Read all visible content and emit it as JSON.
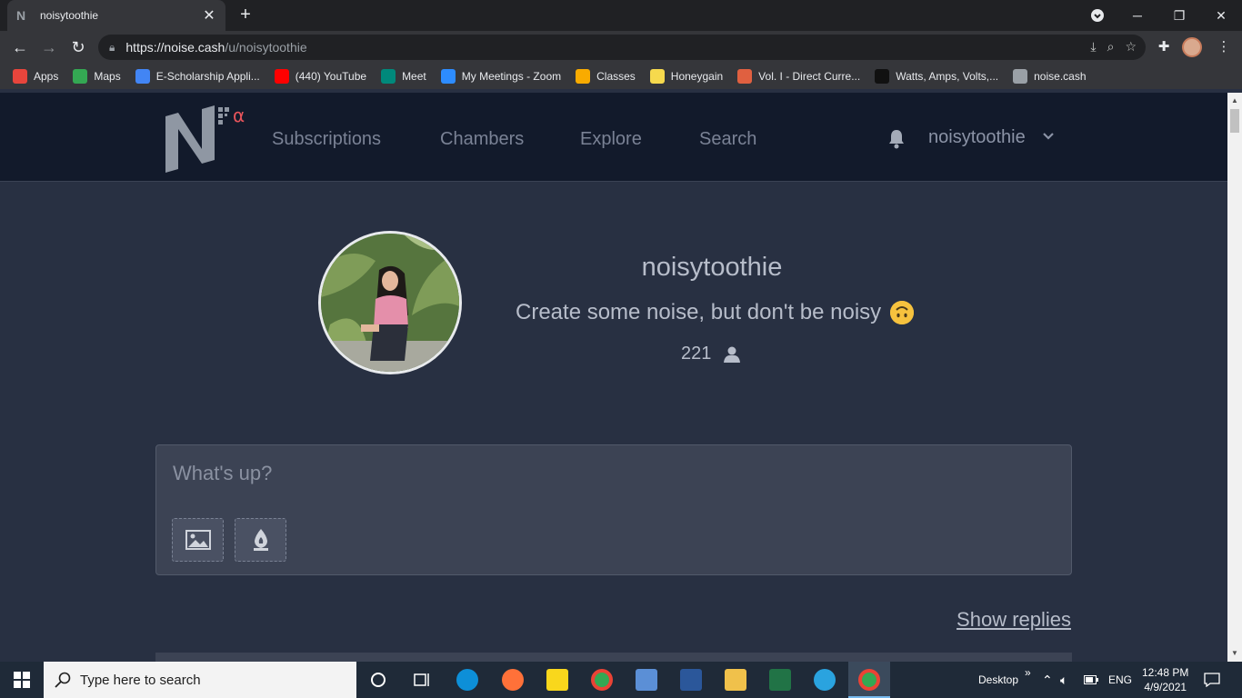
{
  "browser": {
    "tab_title": "noisytoothie",
    "url_host": "https://noise.cash",
    "url_path": "/u/noisytoothie",
    "bookmarks": [
      {
        "label": "Apps",
        "color": "#e8453c"
      },
      {
        "label": "Maps",
        "color": "#34a853"
      },
      {
        "label": "E-Scholarship Appli...",
        "color": "#4285f4"
      },
      {
        "label": "(440) YouTube",
        "color": "#ff0000"
      },
      {
        "label": "Meet",
        "color": "#00897b"
      },
      {
        "label": "My Meetings - Zoom",
        "color": "#2d8cff"
      },
      {
        "label": "Classes",
        "color": "#f9ab00"
      },
      {
        "label": "Honeygain",
        "color": "#f6d94d"
      },
      {
        "label": "Vol. I - Direct Curre...",
        "color": "#e06040"
      },
      {
        "label": "Watts, Amps, Volts,...",
        "color": "#111111"
      },
      {
        "label": "noise.cash",
        "color": "#9aa0a6"
      }
    ]
  },
  "site": {
    "nav": [
      "Subscriptions",
      "Chambers",
      "Explore",
      "Search"
    ],
    "logo_greek": "α",
    "nav_user": "noisytoothie"
  },
  "profile": {
    "name": "noisytoothie",
    "bio": "Create some noise, but don't be noisy",
    "subscribers": "221"
  },
  "composer": {
    "placeholder": "What's up?"
  },
  "feed": {
    "show_replies": "Show replies"
  },
  "taskbar": {
    "search_placeholder": "Type here to search",
    "desktop_label": "Desktop",
    "lang": "ENG",
    "time": "12:48 PM",
    "date": "4/9/2021"
  }
}
